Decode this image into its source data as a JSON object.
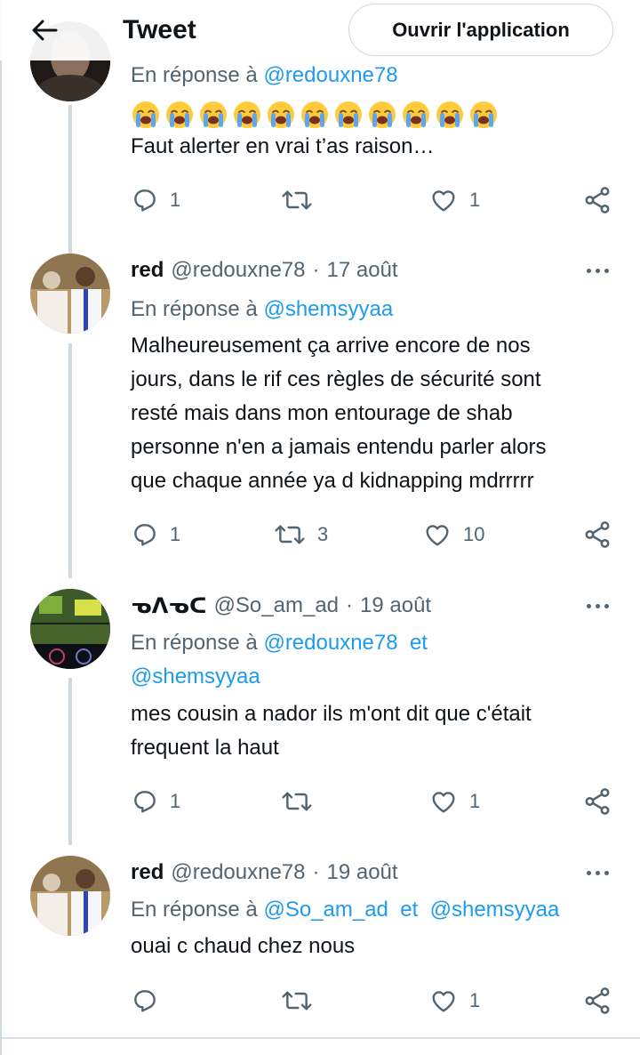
{
  "header": {
    "back_icon": "arrow-left-icon",
    "title": "Tweet",
    "open_app": "Ouvrir l'application"
  },
  "colors": {
    "link": "#1d9bf0",
    "secondary": "#536471",
    "text": "#0f1419",
    "border": "#cfd9de",
    "emoji": "#ffcb3d"
  },
  "tweets": [
    {
      "reply_prefix": "En réponse à",
      "reply_mentions": [
        "@redouxne78"
      ],
      "emoji": "loudly-crying-face",
      "emoji_count": 11,
      "text": "Faut alerter en vrai t’as raison…",
      "replies": "1",
      "retweets": "",
      "likes": "1"
    },
    {
      "name": "red",
      "handle": "@redouxne78",
      "sep": "·",
      "date": "17 août",
      "reply_prefix": "En réponse à",
      "reply_mentions": [
        "@shemsyyaa"
      ],
      "text_lines": [
        "Malheureusement ça arrive encore de nos",
        "jours, dans le rif ces règles de sécurité sont",
        "resté mais dans mon entourage de shab",
        "personne n'en a jamais entendu parler alors",
        "que chaque année ya d kidnapping mdrrrrr"
      ],
      "replies": "1",
      "retweets": "3",
      "likes": "10"
    },
    {
      "name": "ᓀᐱᓀᑕ",
      "handle": "@So_am_ad",
      "sep": "·",
      "date": "19 août",
      "reply_prefix": "En réponse à",
      "reply_mentions": [
        "@redouxne78",
        "@shemsyyaa"
      ],
      "reply_and": "et",
      "text_lines": [
        "mes cousin a nador ils m'ont dit que c'était",
        "frequent la haut"
      ],
      "replies": "1",
      "retweets": "",
      "likes": "1"
    },
    {
      "name": "red",
      "handle": "@redouxne78",
      "sep": "·",
      "date": "19 août",
      "reply_prefix": "En réponse à",
      "reply_mentions": [
        "@So_am_ad",
        "@shemsyyaa"
      ],
      "reply_and": "et",
      "text": "ouai c chaud chez nous",
      "replies": "",
      "retweets": "",
      "likes": "1"
    }
  ]
}
